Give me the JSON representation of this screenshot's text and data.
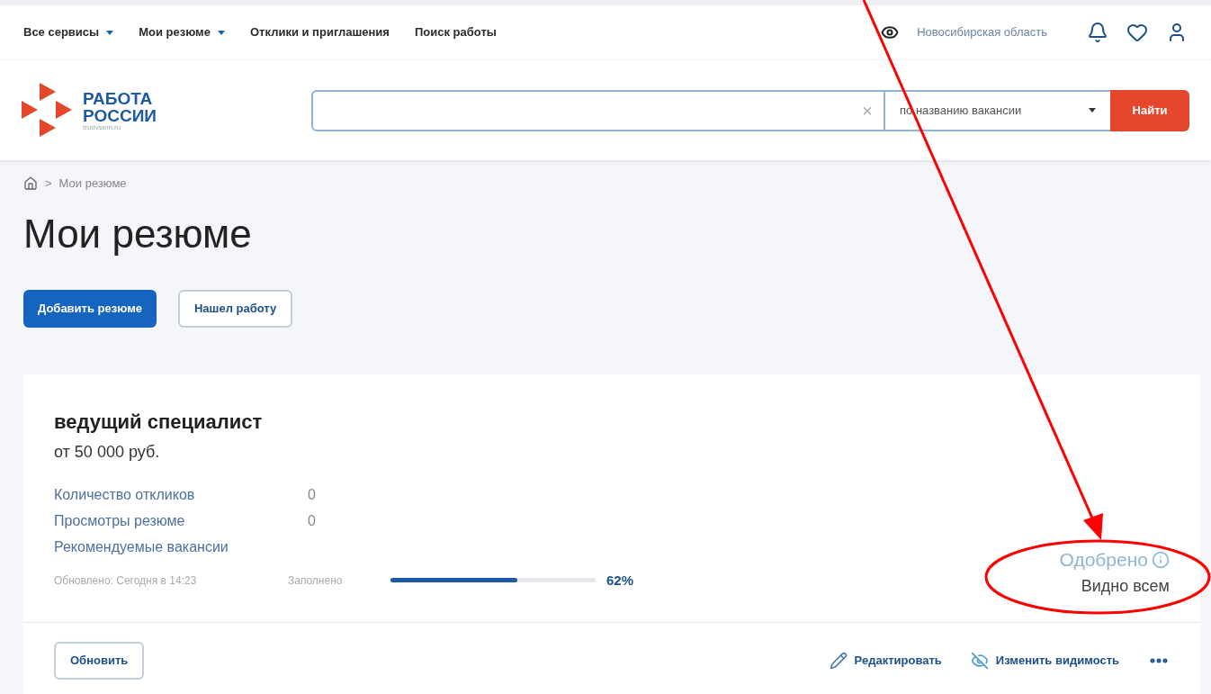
{
  "top_nav": {
    "items": [
      {
        "label": "Все сервисы",
        "has_menu": true
      },
      {
        "label": "Мои резюме",
        "has_menu": true
      },
      {
        "label": "Отклики и приглашения",
        "has_menu": false
      },
      {
        "label": "Поиск работы",
        "has_menu": false
      }
    ],
    "region": "Новосибирская область"
  },
  "logo": {
    "line_1": "РАБОТА",
    "line_2": "РОССИИ",
    "site": "trudvsem.ru"
  },
  "search": {
    "clear": "×",
    "mode": "по названию вакансии",
    "button": "Найти"
  },
  "breadcrumb": {
    "separator": ">",
    "current": "Мои резюме"
  },
  "page_title": "Мои резюме",
  "actions": [
    "Добавить резюме",
    "Нашел работу"
  ],
  "resume": {
    "title": "ведущий специалист",
    "salary": "от 50 000 руб.",
    "stats": [
      {
        "label": "Количество откликов",
        "value": "0"
      },
      {
        "label": "Просмотры резюме",
        "value": "0"
      },
      {
        "label": "Рекомендуемые вакансии"
      }
    ],
    "updated": "Обновлено: Сегодня в 14:23",
    "filled_label": "Заполнено",
    "level": 0.62,
    "filled_reading": "62%",
    "status": "Одобрено",
    "visibility": "Видно всем",
    "refresh_button": "Обновить",
    "edit_link": "Редактировать",
    "visibility_link": "Изменить видимость"
  }
}
